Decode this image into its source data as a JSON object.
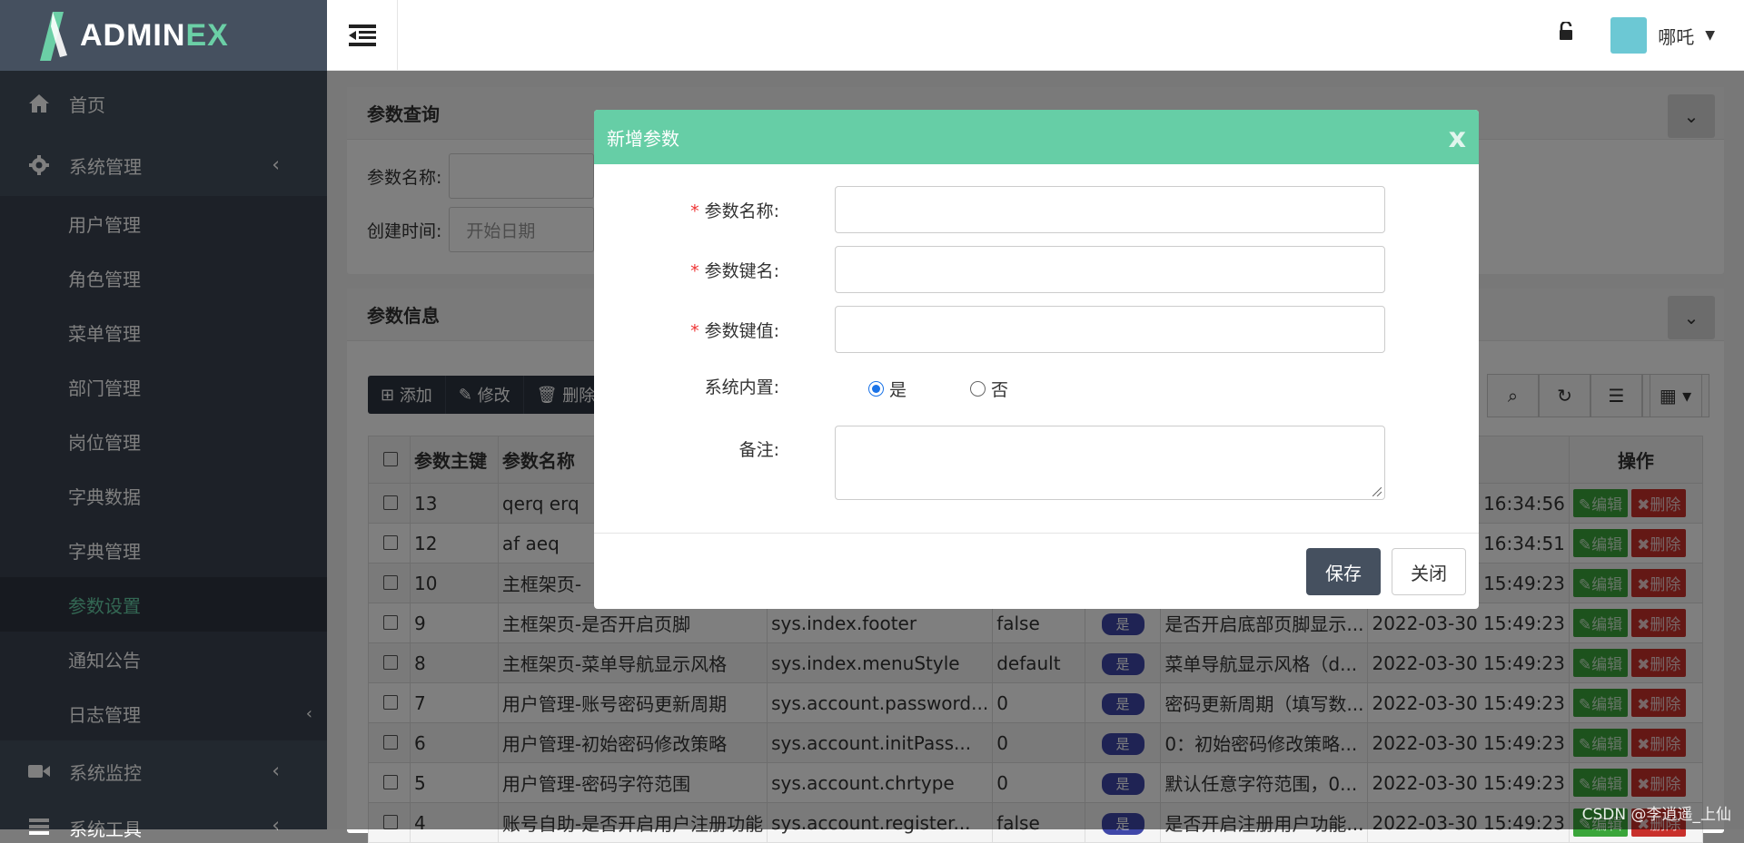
{
  "brand": {
    "text_main": "ADMIN",
    "text_accent": "EX",
    "accent": "#6bcfa6"
  },
  "sidebar": {
    "home": "首页",
    "sys_mgmt": "系统管理",
    "sub_items": [
      "用户管理",
      "角色管理",
      "菜单管理",
      "部门管理",
      "岗位管理",
      "字典数据",
      "字典管理",
      "参数设置",
      "通知公告",
      "日志管理"
    ],
    "active_sub": "参数设置",
    "sys_monitor": "系统监控",
    "sys_tools": "系统工具"
  },
  "topbar": {
    "user_name": "哪吒"
  },
  "query_panel": {
    "title": "参数查询",
    "name_label": "参数名称:",
    "time_label": "创建时间:",
    "start_placeholder": "开始日期"
  },
  "info_panel": {
    "title": "参数信息"
  },
  "toolbar": {
    "add": "添加",
    "edit": "修改",
    "delete": "删除"
  },
  "table": {
    "headers": [
      "参数主键",
      "参数名称",
      "操作"
    ],
    "rows": [
      {
        "id": "13",
        "name": "qerq erq",
        "key": "",
        "value": "",
        "builtin": "",
        "remark": "",
        "time": "16:34:56"
      },
      {
        "id": "12",
        "name": "af aeq",
        "key": "",
        "value": "",
        "builtin": "",
        "remark": "",
        "time": "16:34:51"
      },
      {
        "id": "10",
        "name": "主框架页-",
        "key": "",
        "value": "",
        "builtin": "",
        "remark": "",
        "time": "15:49:23"
      },
      {
        "id": "9",
        "name": "主框架页-是否开启页脚",
        "key": "sys.index.footer",
        "value": "false",
        "builtin": "是",
        "remark": "是否开启底部页脚显示...",
        "time": "2022-03-30 15:49:23"
      },
      {
        "id": "8",
        "name": "主框架页-菜单导航显示风格",
        "key": "sys.index.menuStyle",
        "value": "default",
        "builtin": "是",
        "remark": "菜单导航显示风格（d...",
        "time": "2022-03-30 15:49:23"
      },
      {
        "id": "7",
        "name": "用户管理-账号密码更新周期",
        "key": "sys.account.password...",
        "value": "0",
        "builtin": "是",
        "remark": "密码更新周期（填写数...",
        "time": "2022-03-30 15:49:23"
      },
      {
        "id": "6",
        "name": "用户管理-初始密码修改策略",
        "key": "sys.account.initPass...",
        "value": "0",
        "builtin": "是",
        "remark": "0：初始密码修改策略...",
        "time": "2022-03-30 15:49:23"
      },
      {
        "id": "5",
        "name": "用户管理-密码字符范围",
        "key": "sys.account.chrtype",
        "value": "0",
        "builtin": "是",
        "remark": "默认任意字符范围，0...",
        "time": "2022-03-30 15:49:23"
      },
      {
        "id": "4",
        "name": "账号自助-是否开启用户注册功能",
        "key": "sys.account.register...",
        "value": "false",
        "builtin": "是",
        "remark": "是否开启注册用户功能...",
        "time": "2022-03-30 15:49:23"
      }
    ],
    "edit_btn": "编辑",
    "delete_btn": "删除"
  },
  "modal": {
    "title": "新增参数",
    "close_glyph": "x",
    "fields": {
      "name": "参数名称:",
      "key": "参数键名:",
      "value": "参数键值:",
      "builtin": "系统内置:",
      "remark": "备注:"
    },
    "required_mark": "*",
    "radio_yes": "是",
    "radio_no": "否",
    "radio_selected": "是",
    "save": "保存",
    "close": "关闭"
  },
  "watermark": "CSDN @李逍遥_上仙"
}
